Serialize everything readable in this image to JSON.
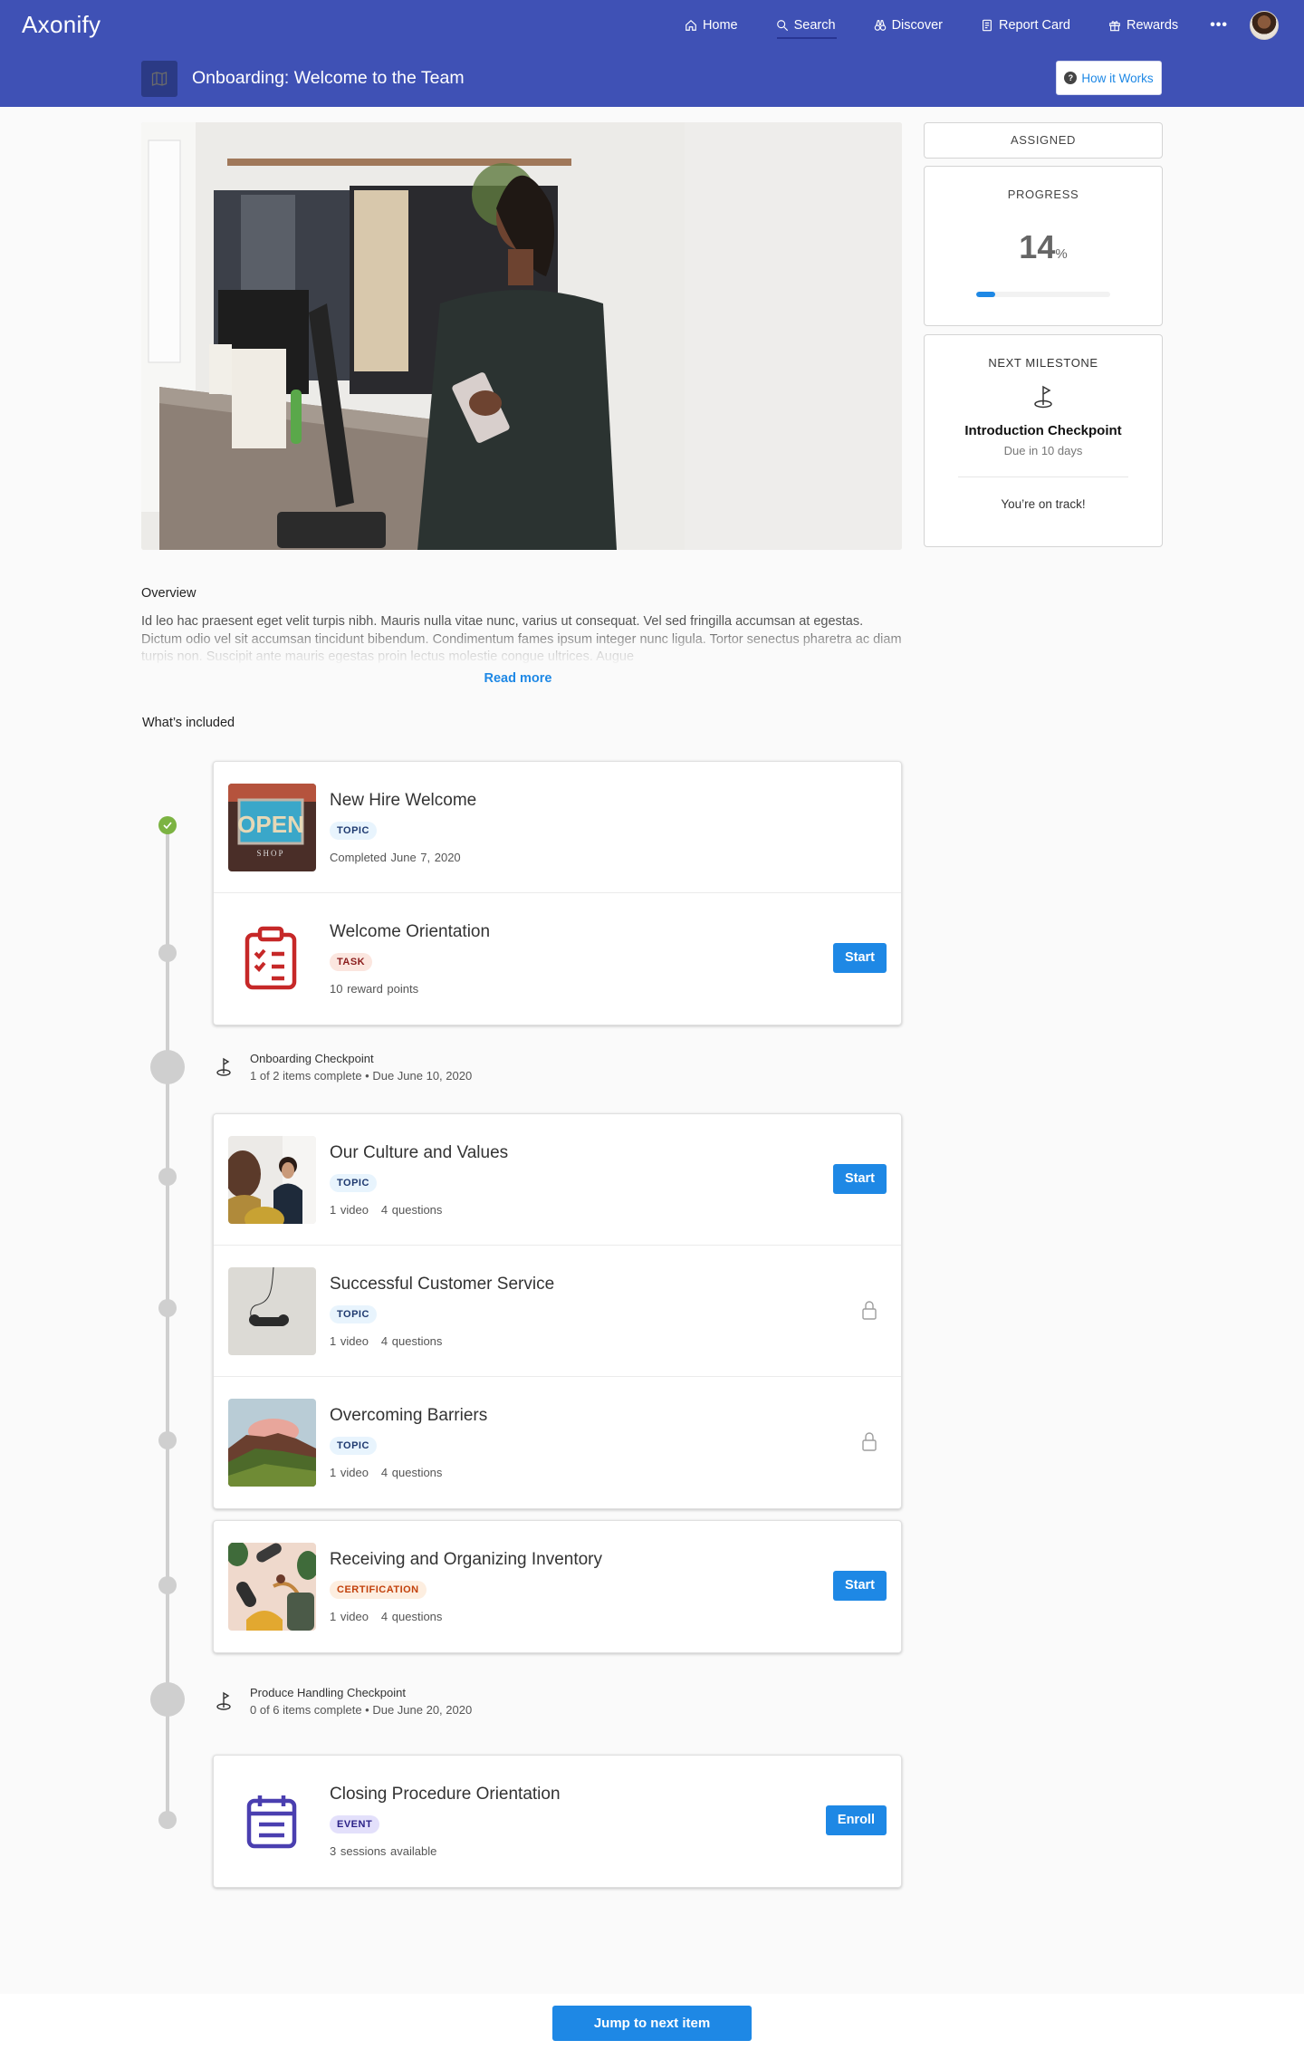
{
  "app": {
    "logo": "Axonify"
  },
  "nav": {
    "items": [
      {
        "label": "Home",
        "icon": "home-icon"
      },
      {
        "label": "Search",
        "icon": "search-icon",
        "active": true
      },
      {
        "label": "Discover",
        "icon": "binoculars-icon"
      },
      {
        "label": "Report Card",
        "icon": "report-card-icon"
      },
      {
        "label": "Rewards",
        "icon": "gift-icon"
      }
    ],
    "more_label": "•••"
  },
  "header": {
    "title": "Onboarding: Welcome to the Team",
    "icon": "map-icon",
    "how_it_works_label": "How it Works"
  },
  "status": {
    "assigned_label": "ASSIGNED",
    "progress_label": "PROGRESS",
    "progress_value": "14",
    "progress_unit": "%",
    "progress_fraction": 0.14,
    "next_milestone_label": "NEXT MILESTONE",
    "milestone_name": "Introduction Checkpoint",
    "milestone_due": "Due in 10 days",
    "on_track": "You’re on track!"
  },
  "overview": {
    "title": "Overview",
    "text": "Id leo hac praesent eget velit turpis nibh. Mauris nulla vitae nunc, varius ut consequat. Vel sed fringilla accumsan at egestas. Dictum odio vel sit accumsan tincidunt bibendum. Condimentum fames ipsum integer nunc ligula. Tortor senectus pharetra ac diam turpis non. Suscipit ante mauris egestas proin lectus molestie congue ultrices. Augue",
    "read_more": "Read more"
  },
  "included": {
    "title": "What’s included",
    "groups": [
      {
        "items": [
          {
            "title": "New Hire Welcome",
            "type": "TOPIC",
            "meta": [
              "Completed June 7, 2020"
            ],
            "status": "completed"
          },
          {
            "title": "Welcome Orientation",
            "type": "TASK",
            "meta": [
              "10 reward points"
            ],
            "action": "Start"
          }
        ]
      },
      {
        "checkpoint": {
          "name": "Onboarding Checkpoint",
          "meta": "1 of 2 items complete • Due June 10, 2020"
        }
      },
      {
        "items": [
          {
            "title": "Our Culture and Values",
            "type": "TOPIC",
            "meta": [
              "1 video",
              "4 questions"
            ],
            "action": "Start"
          },
          {
            "title": "Successful Customer Service",
            "type": "TOPIC",
            "meta": [
              "1 video",
              "4 questions"
            ],
            "status": "locked"
          },
          {
            "title": "Overcoming Barriers",
            "type": "TOPIC",
            "meta": [
              "1 video",
              "4 questions"
            ],
            "status": "locked"
          }
        ]
      },
      {
        "items": [
          {
            "title": "Receiving and Organizing Inventory",
            "type": "CERTIFICATION",
            "meta": [
              "1 video",
              "4 questions"
            ],
            "action": "Start"
          }
        ]
      },
      {
        "checkpoint": {
          "name": "Produce Handling Checkpoint",
          "meta": "0 of 6 items complete • Due June 20, 2020"
        }
      },
      {
        "items": [
          {
            "title": "Closing Procedure Orientation",
            "type": "EVENT",
            "meta": [
              "3 sessions available"
            ],
            "action": "Enroll"
          }
        ]
      }
    ]
  },
  "footer": {
    "jump_label": "Jump to next item"
  },
  "colors": {
    "brand": "#3f51b5",
    "accent": "#1e88e5",
    "complete": "#7cb342",
    "task": "#c62828",
    "event": "#4a3fb0"
  }
}
